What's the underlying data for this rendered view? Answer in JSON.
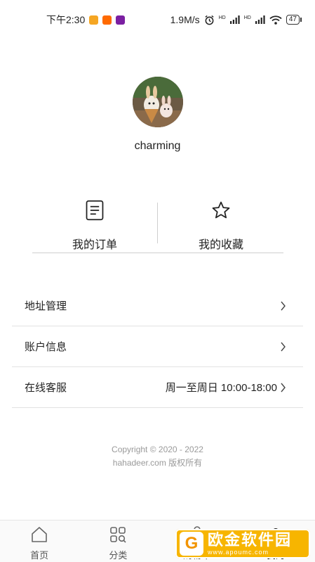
{
  "status_bar": {
    "time": "下午2:30",
    "net_speed": "1.9M/s",
    "signal_tag_1": "HD",
    "signal_tag_2": "HD",
    "battery": "47"
  },
  "profile": {
    "username": "charming"
  },
  "quick_actions": [
    {
      "label": "我的订单",
      "icon": "order-list-icon"
    },
    {
      "label": "我的收藏",
      "icon": "star-icon"
    }
  ],
  "settings": [
    {
      "label": "地址管理",
      "value": ""
    },
    {
      "label": "账户信息",
      "value": ""
    },
    {
      "label": "在线客服",
      "value": "周一至周日 10:00-18:00"
    }
  ],
  "copyright": {
    "line1": "Copyright © 2020 - 2022",
    "line2": "hahadeer.com 版权所有"
  },
  "tabbar": {
    "tabs": [
      {
        "label": "首页",
        "icon": "home-icon"
      },
      {
        "label": "分类",
        "icon": "category-grid-icon"
      },
      {
        "label": "购物车",
        "icon": "cart-icon"
      },
      {
        "label": "我的",
        "icon": "profile-icon"
      }
    ],
    "active_index": 3
  },
  "watermark": {
    "title": "欧金软件园",
    "url": "www.apoumc.com",
    "logo_glyph": "G"
  },
  "colors": {
    "watermark_bg": "#f7b500",
    "text_primary": "#222222",
    "text_muted": "#9a9a9a"
  }
}
